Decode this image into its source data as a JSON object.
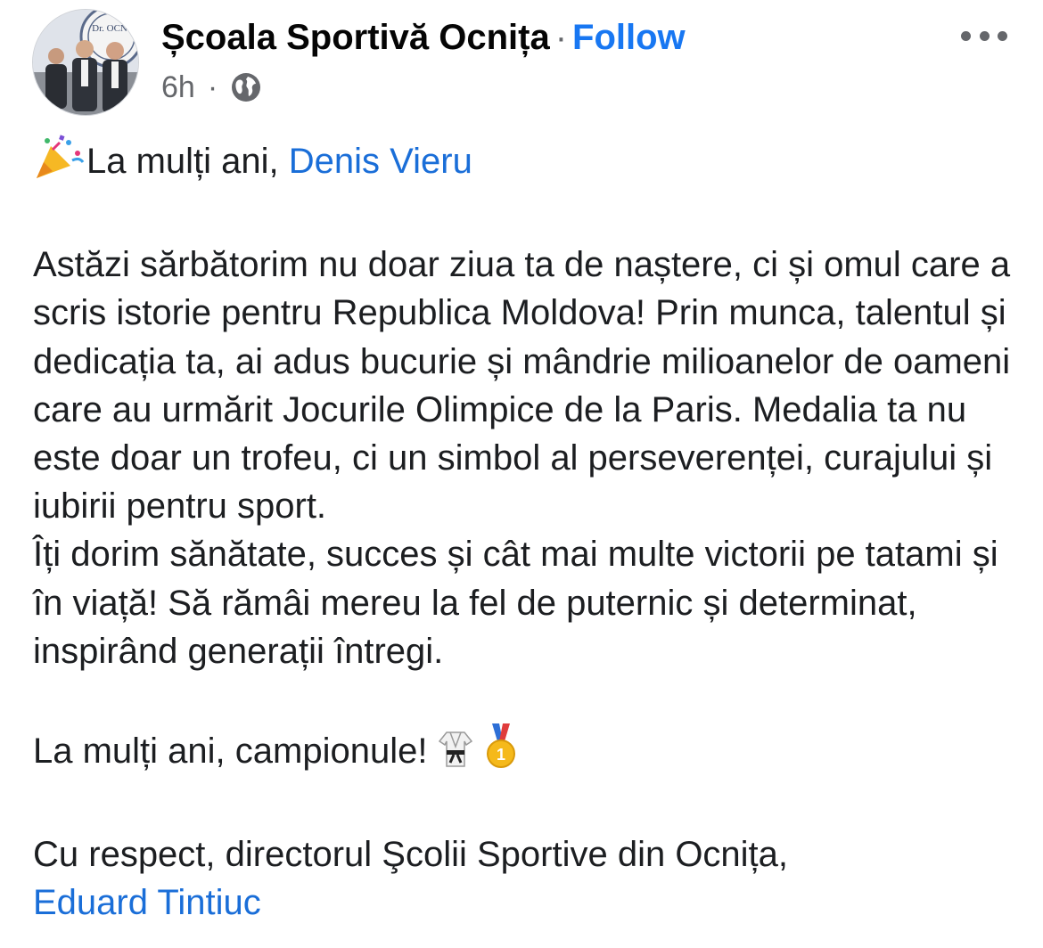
{
  "header": {
    "page_name": "Școala Sportivă Ocnița",
    "separator": "·",
    "follow_label": "Follow",
    "time": "6h",
    "meta_separator": "·",
    "audience_icon": "globe-icon",
    "more_icon": "more-options-icon"
  },
  "avatar": {
    "logo_text": "Dr. OCN"
  },
  "post": {
    "greeting_emoji": "party-popper-icon",
    "greeting_text": "La mulți ani, ",
    "greeting_tag": "Denis Vieru",
    "paragraph_1": "Astăzi sărbătorim nu doar ziua ta de naștere, ci și omul care a scris istorie pentru Republica Moldova! Prin munca, talentul și dedicația ta, ai adus bucurie și mândrie milioanelor de oameni care au urmărit Jocurile Olimpice de la Paris. Medalia ta nu este doar un trofeu, ci un simbol al perseverenței, curajului și iubirii pentru sport.",
    "paragraph_2": "Îți dorim sănătate, succes și cât mai multe victorii pe tatami și în viață! Să rămâi mereu la fel de puternic și determinat, inspirând generații întregi.",
    "closing_text": "La mulți ani, campionule! ",
    "closing_emojis": [
      "martial-arts-uniform-icon",
      "first-place-medal-icon"
    ],
    "signature_text": "Cu respect,  directorul Şcolii Sportive din Ocnița,",
    "signature_tag": "Eduard Tintiuc"
  },
  "colors": {
    "link": "#1a6ed8",
    "follow": "#1877f2",
    "meta": "#65676b",
    "text": "#1c1e21"
  }
}
